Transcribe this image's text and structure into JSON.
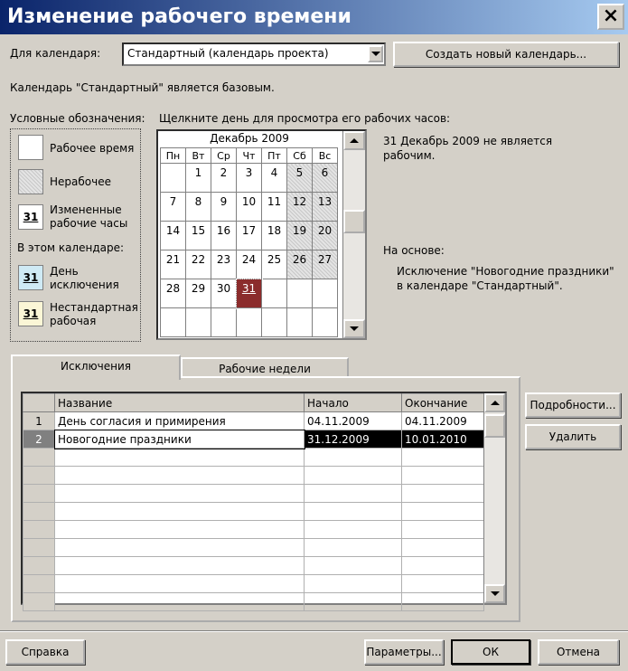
{
  "window": {
    "title": "Изменение рабочего времени",
    "close": "×"
  },
  "calendar_label": "Для календаря:",
  "calendar_value": "Стандартный (календарь проекта)",
  "create_button": "Создать новый календарь...",
  "base_info": "Календарь \"Стандартный\" является базовым.",
  "legend": {
    "title": "Условные обозначения:",
    "working": "Рабочее время",
    "nonworking": "Нерабочее",
    "changed": "Измененные рабочие часы",
    "sample_day": "31",
    "in_calendar": "В этом календаре:",
    "exception": "День исключения",
    "nonstandard": "Нестандартная рабочая"
  },
  "click_hint": "Щелкните день для просмотра его рабочих часов:",
  "calendar": {
    "month": "Декабрь 2009",
    "weekdays": [
      "Пн",
      "Вт",
      "Ср",
      "Чт",
      "Пт",
      "Сб",
      "Вс"
    ],
    "weeks": [
      [
        "",
        "1",
        "2",
        "3",
        "4",
        "5",
        "6"
      ],
      [
        "7",
        "8",
        "9",
        "10",
        "11",
        "12",
        "13"
      ],
      [
        "14",
        "15",
        "16",
        "17",
        "18",
        "19",
        "20"
      ],
      [
        "21",
        "22",
        "23",
        "24",
        "25",
        "26",
        "27"
      ],
      [
        "28",
        "29",
        "30",
        "31",
        "",
        "",
        ""
      ],
      [
        "",
        "",
        "",
        "",
        "",
        "",
        ""
      ]
    ],
    "selected_day": "31"
  },
  "day_info": "31 Декабрь 2009 не является рабочим.",
  "based_on_label": "На основе:",
  "based_on_text": "Исключение \"Новогодние праздники\" в календаре \"Стандартный\".",
  "tabs": [
    "Исключения",
    "Рабочие недели"
  ],
  "grid": {
    "headers": [
      "Название",
      "Начало",
      "Окончание"
    ],
    "rows": [
      {
        "num": "1",
        "name": "День согласия и примирения",
        "start": "04.11.2009",
        "end": "04.11.2009"
      },
      {
        "num": "2",
        "name": "Новогодние праздники",
        "start": "31.12.2009",
        "end": "10.01.2010"
      }
    ],
    "empty_rows": 9
  },
  "details_button": "Подробности...",
  "delete_button": "Удалить",
  "help_button": "Справка",
  "params_button": "Параметры...",
  "ok_button": "ОК",
  "cancel_button": "Отмена",
  "colors": {
    "title_start": "#0a246a",
    "title_end": "#a6caf0",
    "selected_day": "#8b2c2c",
    "exception_swatch": "#cfeaf5",
    "nonstandard_swatch": "#fbf6d6"
  }
}
